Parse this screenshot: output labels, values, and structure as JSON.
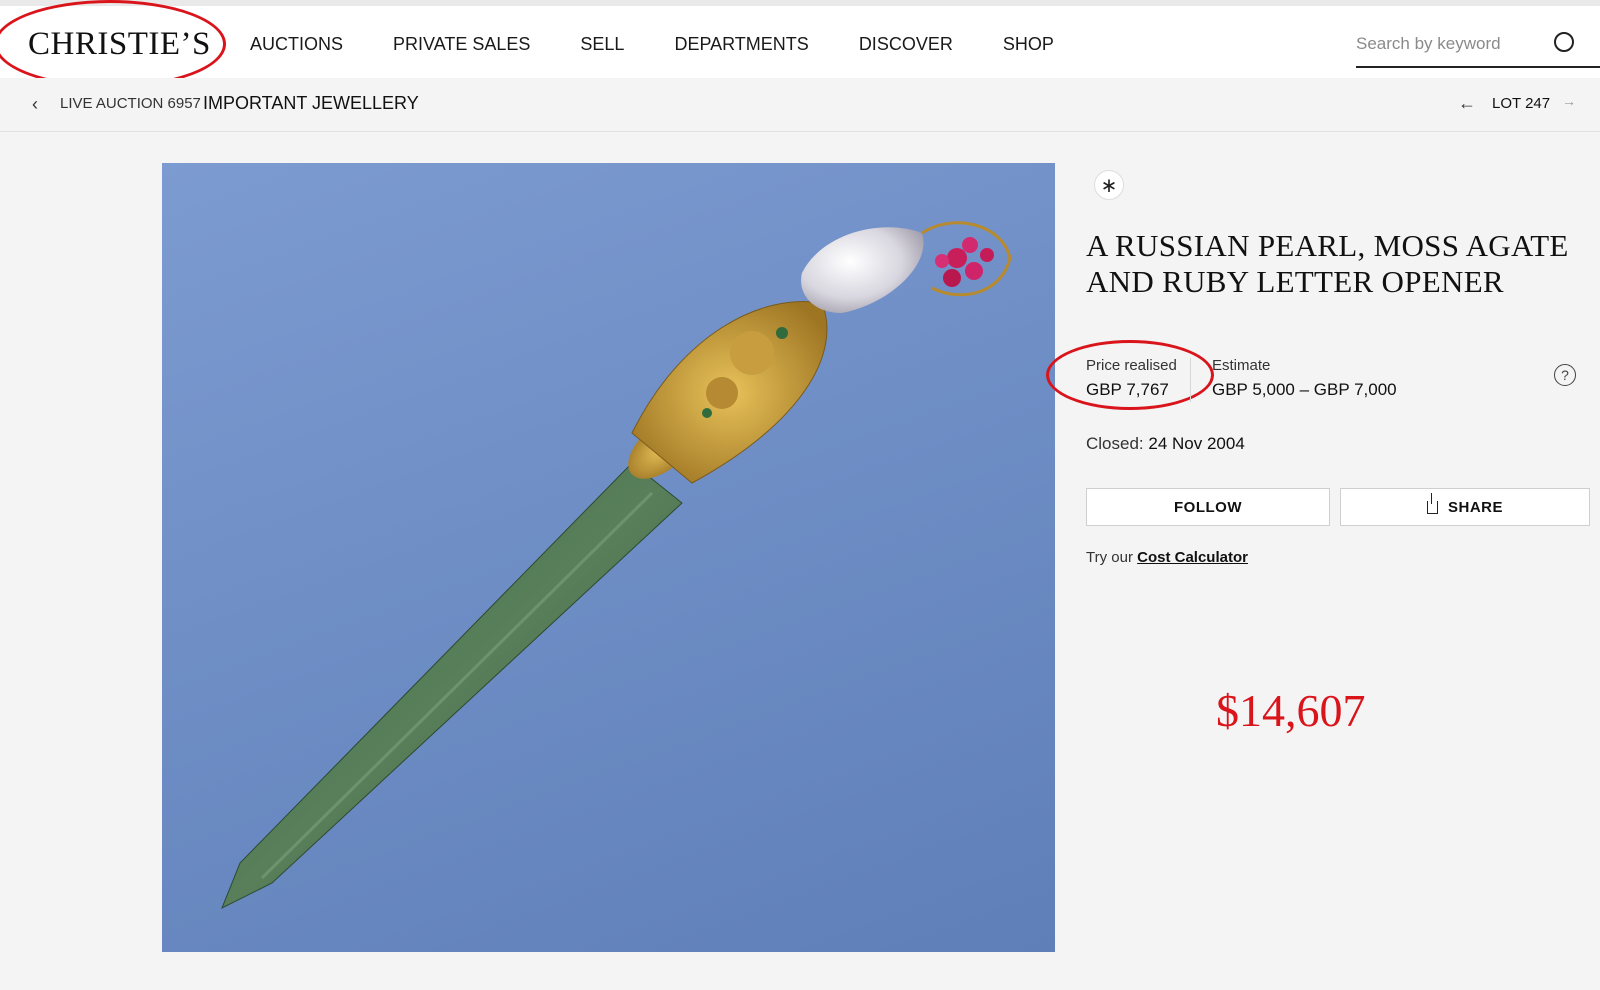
{
  "header": {
    "logo": "CHRISTIE’S",
    "nav": [
      "AUCTIONS",
      "PRIVATE SALES",
      "SELL",
      "DEPARTMENTS",
      "DISCOVER",
      "SHOP"
    ],
    "search_placeholder": "Search by keyword"
  },
  "breadcrumb": {
    "prefix": "LIVE AUCTION 6957",
    "title": "IMPORTANT JEWELLERY",
    "lot": "LOT 247"
  },
  "lot": {
    "title": "A RUSSIAN PEARL, MOSS AGATE AND RUBY LETTER OPENER",
    "price_label": "Price realised",
    "price_value": "GBP 7,767",
    "estimate_label": "Estimate",
    "estimate_value": "GBP 5,000 – GBP 7,000",
    "closed_label": "Closed:",
    "closed_value": "24 Nov 2004",
    "follow_label": "FOLLOW",
    "share_label": "SHARE",
    "calc_prefix": "Try our",
    "calc_link": "Cost Calculator"
  },
  "annotation": {
    "usd_price": "$14,607",
    "highlight_color": "#d9151b"
  },
  "icons": {
    "back": "chevron-left-icon",
    "search": "search-icon",
    "badge": "asterisk-icon",
    "help": "question-icon",
    "share": "share-icon"
  }
}
